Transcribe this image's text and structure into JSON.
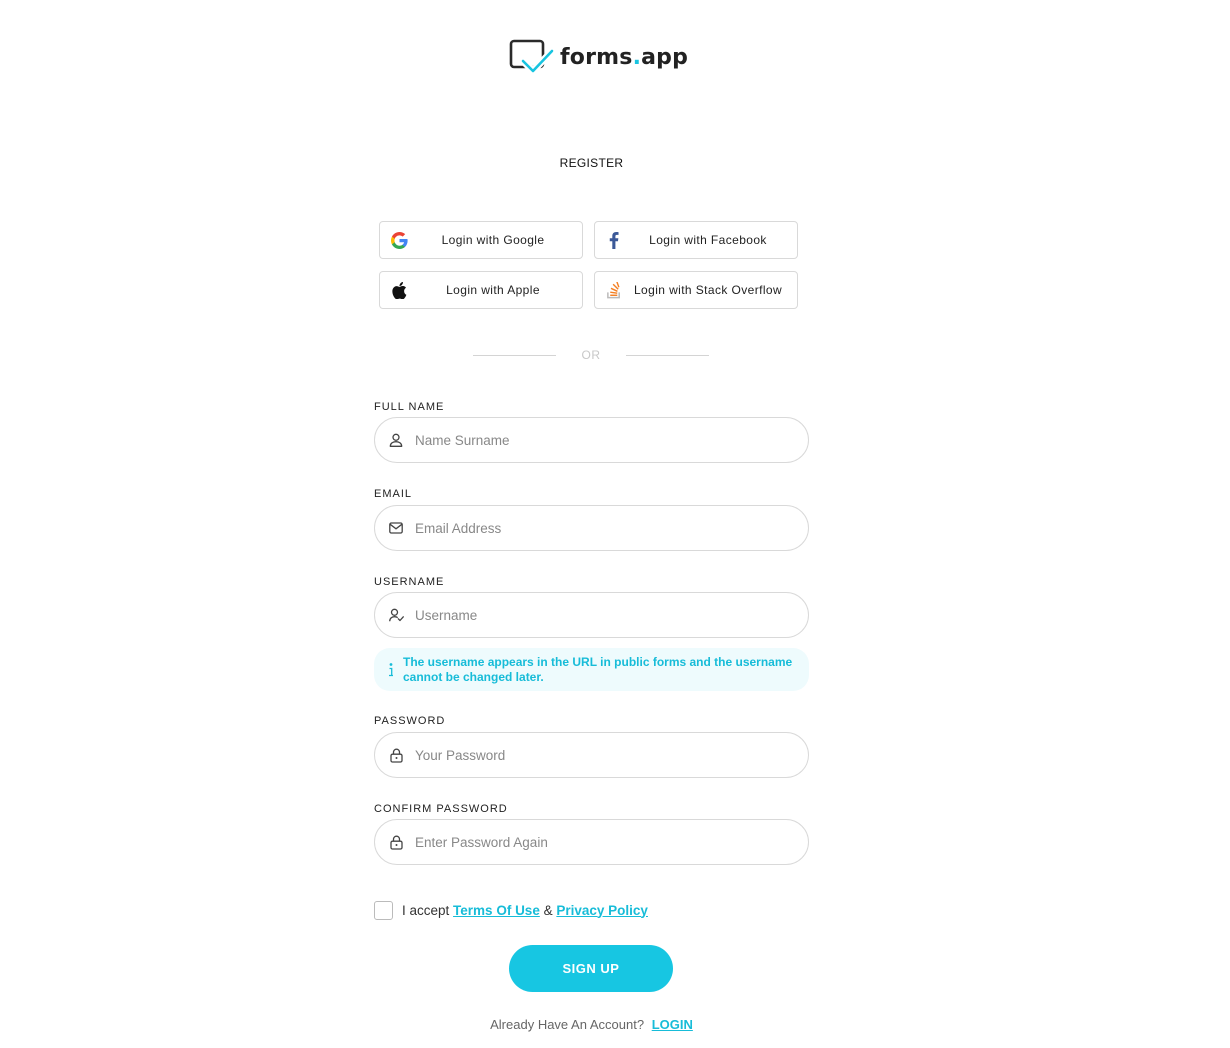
{
  "brand": {
    "name_main": "forms",
    "name_dot": ".",
    "name_tld": "app"
  },
  "page": {
    "title": "REGISTER"
  },
  "social": {
    "google": "Login with Google",
    "facebook": "Login with Facebook",
    "apple": "Login with Apple",
    "stackoverflow": "Login with Stack Overflow"
  },
  "divider": "OR",
  "form": {
    "full_name": {
      "label": "FULL NAME",
      "placeholder": "Name Surname",
      "value": ""
    },
    "email": {
      "label": "EMAIL",
      "placeholder": "Email Address",
      "value": ""
    },
    "username": {
      "label": "USERNAME",
      "placeholder": "Username",
      "value": ""
    },
    "username_notice": "The username appears in the URL in public forms and the username cannot be changed later.",
    "password": {
      "label": "PASSWORD",
      "placeholder": "Your Password",
      "value": ""
    },
    "confirm_password": {
      "label": "CONFIRM PASSWORD",
      "placeholder": "Enter Password Again",
      "value": ""
    }
  },
  "terms": {
    "prefix": "I accept",
    "terms_link": "Terms Of Use",
    "amp": "&",
    "privacy_link": "Privacy Policy",
    "checked": false
  },
  "signup_button": "SIGN UP",
  "footer": {
    "question": "Already Have An Account?",
    "login_link": "LOGIN"
  },
  "colors": {
    "accent": "#17c6e2",
    "notice_bg": "#eefbfd",
    "border": "#d9d9d9"
  },
  "icons": {
    "logo": "forms-app-logo-icon",
    "google": "google-icon",
    "facebook": "facebook-icon",
    "apple": "apple-icon",
    "stackoverflow": "stackoverflow-icon",
    "user": "user-icon",
    "email": "envelope-icon",
    "username": "user-check-icon",
    "info": "info-icon",
    "lock": "lock-icon"
  }
}
